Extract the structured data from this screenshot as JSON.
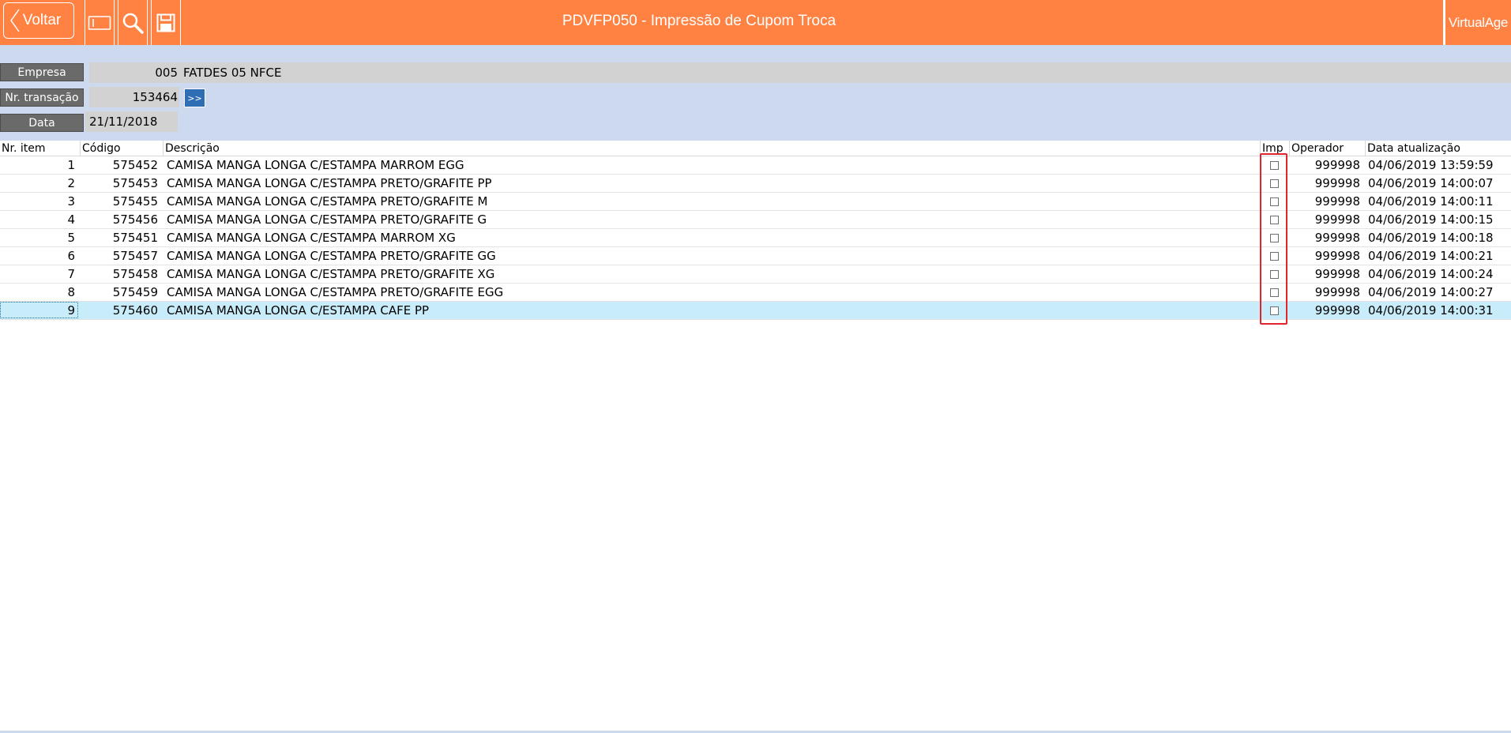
{
  "header": {
    "back_label": "Voltar",
    "title": "PDVFP050 - Impressão de Cupom Troca",
    "brand": "VirtualAge",
    "tools": [
      "panel-toggle-icon",
      "search-icon",
      "save-icon"
    ],
    "accent_color": "#ff8243"
  },
  "form": {
    "empresa_label": "Empresa",
    "empresa_code": "005",
    "empresa_name": "FATDES 05 NFCE",
    "transacao_label": "Nr. transação",
    "transacao_value": "153464",
    "transacao_nav": ">>",
    "data_label": "Data",
    "data_value": "21/11/2018"
  },
  "grid": {
    "columns": [
      "Nr. item",
      "Código",
      "Descrição",
      "Imp",
      "Operador",
      "Data atualização"
    ],
    "rows": [
      {
        "item": "1",
        "codigo": "575452",
        "descricao": "CAMISA MANGA LONGA C/ESTAMPA MARROM EGG",
        "imp": false,
        "operador": "999998",
        "data": "04/06/2019 13:59:59"
      },
      {
        "item": "2",
        "codigo": "575453",
        "descricao": "CAMISA MANGA LONGA C/ESTAMPA PRETO/GRAFITE PP",
        "imp": false,
        "operador": "999998",
        "data": "04/06/2019 14:00:07"
      },
      {
        "item": "3",
        "codigo": "575455",
        "descricao": "CAMISA MANGA LONGA C/ESTAMPA PRETO/GRAFITE M",
        "imp": false,
        "operador": "999998",
        "data": "04/06/2019 14:00:11"
      },
      {
        "item": "4",
        "codigo": "575456",
        "descricao": "CAMISA MANGA LONGA C/ESTAMPA PRETO/GRAFITE G",
        "imp": false,
        "operador": "999998",
        "data": "04/06/2019 14:00:15"
      },
      {
        "item": "5",
        "codigo": "575451",
        "descricao": "CAMISA MANGA LONGA C/ESTAMPA MARROM XG",
        "imp": false,
        "operador": "999998",
        "data": "04/06/2019 14:00:18"
      },
      {
        "item": "6",
        "codigo": "575457",
        "descricao": "CAMISA MANGA LONGA C/ESTAMPA PRETO/GRAFITE GG",
        "imp": false,
        "operador": "999998",
        "data": "04/06/2019 14:00:21"
      },
      {
        "item": "7",
        "codigo": "575458",
        "descricao": "CAMISA MANGA LONGA C/ESTAMPA PRETO/GRAFITE XG",
        "imp": false,
        "operador": "999998",
        "data": "04/06/2019 14:00:24"
      },
      {
        "item": "8",
        "codigo": "575459",
        "descricao": "CAMISA MANGA LONGA C/ESTAMPA PRETO/GRAFITE EGG",
        "imp": false,
        "operador": "999998",
        "data": "04/06/2019 14:00:27"
      },
      {
        "item": "9",
        "codigo": "575460",
        "descricao": "CAMISA MANGA LONGA C/ESTAMPA CAFE PP",
        "imp": false,
        "operador": "999998",
        "data": "04/06/2019 14:00:31",
        "selected": true
      }
    ]
  }
}
